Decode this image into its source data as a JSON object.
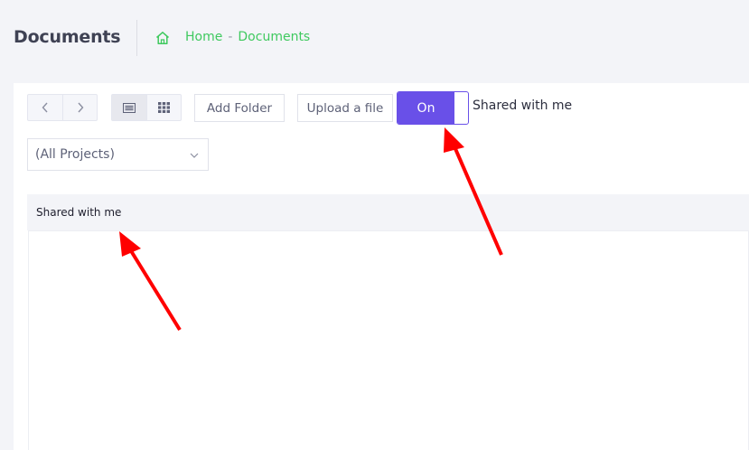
{
  "header": {
    "title": "Documents",
    "breadcrumb": [
      {
        "label": "Home"
      },
      {
        "label": "Documents"
      }
    ],
    "separator": "-"
  },
  "toolbar": {
    "nav_prev_icon": "chevron-left-icon",
    "nav_next_icon": "chevron-right-icon",
    "list_view_icon": "list-view-icon",
    "grid_view_icon": "grid-view-icon",
    "add_folder_label": "Add Folder",
    "upload_label": "Upload a file",
    "toggle": {
      "label": "On",
      "state": true,
      "caption": "Shared with me"
    }
  },
  "filter": {
    "project_select": "(All Projects)"
  },
  "section": {
    "title": "Shared with me"
  },
  "colors": {
    "accent": "#6950e8",
    "breadcrumb": "#3fc95f",
    "annotation_arrow": "#ff0000"
  }
}
